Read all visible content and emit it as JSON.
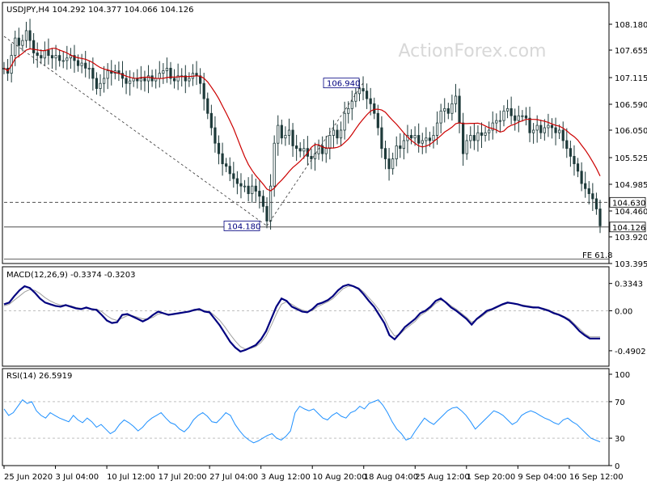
{
  "chart_data": {
    "type": "candlestick",
    "instrument": "USDJPY,H4",
    "ohlc_values": "104.292 104.377 104.066 104.126",
    "watermark": "ActionForex.com",
    "colors": {
      "candle": "#1e3a3a",
      "ma": "#cc0000",
      "trend": "#333333",
      "level": "#333333",
      "macd": "#00007f",
      "signal": "#a0a0a0",
      "rsi": "#1e90ff",
      "watermark": "#d8d8d8"
    },
    "price_axis": {
      "ticks": [
        "108.180",
        "107.655",
        "107.115",
        "106.590",
        "106.050",
        "105.525",
        "104.985",
        "104.460",
        "103.920",
        "103.395"
      ],
      "range": [
        103.395,
        108.4
      ]
    },
    "levels": [
      {
        "label": "104.630",
        "value": 104.63,
        "style": "dashed"
      },
      {
        "label": "104.126",
        "value": 104.126,
        "style": "solid"
      },
      {
        "label": "",
        "value": 103.48,
        "style": "solid"
      }
    ],
    "annotations": {
      "low_label": "104.180",
      "high_label": "106.940",
      "fe_label": "FE 61.8"
    },
    "price": [
      107.3,
      107.2,
      107.55,
      107.9,
      107.75,
      107.85,
      108.05,
      107.85,
      107.6,
      107.55,
      107.5,
      107.65,
      107.55,
      107.5,
      107.55,
      107.45,
      107.45,
      107.5,
      107.55,
      107.45,
      107.35,
      107.4,
      107.3,
      107.3,
      107.1,
      106.9,
      107.0,
      107.1,
      107.25,
      107.2,
      107.25,
      107.2,
      107.1,
      107.0,
      107.05,
      107.1,
      107.05,
      107.1,
      107.05,
      107.15,
      107.05,
      107.1,
      107.2,
      107.25,
      107.3,
      107.1,
      107.05,
      107.15,
      107.15,
      107.05,
      107.1,
      107.2,
      107.15,
      107.0,
      106.7,
      106.4,
      106.1,
      105.8,
      105.6,
      105.4,
      105.35,
      105.2,
      105.1,
      105.0,
      104.95,
      104.95,
      104.8,
      104.95,
      104.85,
      104.75,
      104.55,
      104.25,
      104.95,
      105.8,
      106.15,
      105.9,
      105.95,
      106.05,
      105.75,
      105.7,
      105.65,
      105.7,
      105.55,
      105.5,
      105.6,
      105.75,
      105.6,
      105.7,
      105.95,
      106.05,
      105.9,
      106.05,
      106.4,
      106.5,
      106.65,
      106.8,
      106.9,
      106.85,
      106.7,
      106.6,
      106.4,
      106.1,
      105.7,
      105.5,
      105.3,
      105.5,
      105.75,
      105.7,
      105.85,
      105.95,
      105.9,
      105.95,
      105.8,
      105.85,
      105.9,
      105.85,
      105.95,
      106.2,
      106.45,
      106.5,
      106.4,
      106.6,
      106.75,
      106.2,
      105.6,
      105.85,
      105.95,
      105.85,
      106.0,
      105.95,
      106.0,
      106.05,
      106.2,
      106.25,
      106.25,
      106.45,
      106.5,
      106.35,
      106.25,
      106.35,
      106.35,
      106.3,
      106.0,
      106.05,
      106.15,
      106.0,
      106.1,
      106.15,
      106.1,
      106.0,
      106.05,
      105.85,
      105.7,
      105.55,
      105.4,
      105.25,
      105.0,
      104.9,
      104.8,
      104.7,
      104.5,
      104.15
    ],
    "macd_axis": {
      "ticks": [
        "0.3343",
        "0.00",
        "-0.4902"
      ],
      "range": [
        -0.6,
        0.45
      ]
    },
    "macd_label": "MACD(12,26,9) -0.3374 -0.3203",
    "macd": [
      0.08,
      0.1,
      0.18,
      0.25,
      0.3,
      0.28,
      0.22,
      0.15,
      0.1,
      0.08,
      0.06,
      0.05,
      0.07,
      0.05,
      0.03,
      0.02,
      0.04,
      0.02,
      0.01,
      -0.05,
      -0.12,
      -0.15,
      -0.14,
      -0.05,
      -0.04,
      -0.07,
      -0.1,
      -0.13,
      -0.1,
      -0.05,
      -0.01,
      -0.03,
      -0.05,
      -0.04,
      -0.03,
      -0.02,
      -0.01,
      0.01,
      0.02,
      -0.01,
      -0.02,
      -0.1,
      -0.18,
      -0.28,
      -0.38,
      -0.45,
      -0.5,
      -0.48,
      -0.45,
      -0.42,
      -0.35,
      -0.25,
      -0.1,
      0.05,
      0.15,
      0.12,
      0.05,
      0.02,
      -0.01,
      -0.02,
      0.02,
      0.08,
      0.1,
      0.13,
      0.18,
      0.25,
      0.3,
      0.32,
      0.3,
      0.27,
      0.2,
      0.12,
      0.05,
      -0.05,
      -0.15,
      -0.3,
      -0.35,
      -0.28,
      -0.2,
      -0.15,
      -0.1,
      -0.03,
      0.0,
      0.05,
      0.12,
      0.15,
      0.1,
      0.04,
      0.0,
      -0.05,
      -0.1,
      -0.17,
      -0.1,
      -0.05,
      0.0,
      0.02,
      0.05,
      0.08,
      0.1,
      0.09,
      0.08,
      0.06,
      0.05,
      0.04,
      0.04,
      0.02,
      0.0,
      -0.03,
      -0.05,
      -0.08,
      -0.12,
      -0.18,
      -0.25,
      -0.3,
      -0.34,
      -0.34,
      -0.34
    ],
    "signal": [
      0.06,
      0.08,
      0.13,
      0.18,
      0.23,
      0.26,
      0.25,
      0.21,
      0.16,
      0.12,
      0.09,
      0.07,
      0.07,
      0.06,
      0.04,
      0.03,
      0.03,
      0.02,
      0.02,
      -0.01,
      -0.06,
      -0.1,
      -0.12,
      -0.09,
      -0.06,
      -0.06,
      -0.08,
      -0.1,
      -0.1,
      -0.08,
      -0.04,
      -0.03,
      -0.04,
      -0.04,
      -0.03,
      -0.02,
      -0.01,
      0.0,
      0.01,
      0.0,
      -0.01,
      -0.06,
      -0.12,
      -0.2,
      -0.29,
      -0.37,
      -0.44,
      -0.47,
      -0.46,
      -0.44,
      -0.39,
      -0.31,
      -0.18,
      -0.04,
      0.08,
      0.11,
      0.08,
      0.04,
      0.01,
      -0.01,
      0.0,
      0.05,
      0.08,
      0.11,
      0.15,
      0.21,
      0.27,
      0.3,
      0.3,
      0.28,
      0.23,
      0.16,
      0.09,
      0.01,
      -0.09,
      -0.22,
      -0.31,
      -0.29,
      -0.23,
      -0.18,
      -0.13,
      -0.06,
      -0.02,
      0.03,
      0.09,
      0.13,
      0.11,
      0.06,
      0.02,
      -0.03,
      -0.08,
      -0.14,
      -0.11,
      -0.07,
      -0.02,
      0.01,
      0.04,
      0.07,
      0.09,
      0.09,
      0.08,
      0.07,
      0.06,
      0.05,
      0.04,
      0.03,
      0.01,
      -0.02,
      -0.04,
      -0.07,
      -0.1,
      -0.16,
      -0.22,
      -0.28,
      -0.32,
      -0.32,
      -0.32
    ],
    "rsi_axis": {
      "ticks": [
        "100",
        "70",
        "30",
        "0"
      ],
      "range": [
        0,
        100
      ]
    },
    "rsi_label": "RSI(14) 26.5919",
    "rsi": [
      62,
      55,
      58,
      65,
      72,
      68,
      70,
      60,
      55,
      52,
      58,
      55,
      52,
      50,
      48,
      55,
      50,
      47,
      52,
      48,
      42,
      45,
      40,
      35,
      38,
      45,
      50,
      47,
      43,
      38,
      42,
      48,
      52,
      55,
      58,
      52,
      47,
      45,
      40,
      37,
      42,
      50,
      55,
      58,
      54,
      48,
      47,
      52,
      58,
      55,
      45,
      38,
      32,
      28,
      25,
      27,
      30,
      33,
      35,
      30,
      28,
      32,
      38,
      58,
      65,
      62,
      60,
      62,
      57,
      52,
      50,
      55,
      58,
      54,
      52,
      58,
      60,
      65,
      62,
      68,
      70,
      72,
      66,
      58,
      48,
      40,
      35,
      28,
      30,
      38,
      45,
      52,
      48,
      45,
      50,
      55,
      60,
      63,
      64,
      60,
      55,
      48,
      40,
      45,
      50,
      55,
      60,
      58,
      55,
      50,
      45,
      48,
      55,
      58,
      60,
      58,
      55,
      52,
      50,
      47,
      45,
      50,
      52,
      48,
      45,
      40,
      35,
      30,
      28,
      26
    ],
    "time_axis": {
      "labels": [
        "25 Jun 2020",
        "3 Jul 04:00",
        "10 Jul 12:00",
        "17 Jul 20:00",
        "27 Jul 04:00",
        "3 Aug 12:00",
        "10 Aug 20:00",
        "18 Aug 04:00",
        "25 Aug 12:00",
        "1 Sep 20:00",
        "9 Sep 04:00",
        "16 Sep 12:00"
      ]
    }
  }
}
